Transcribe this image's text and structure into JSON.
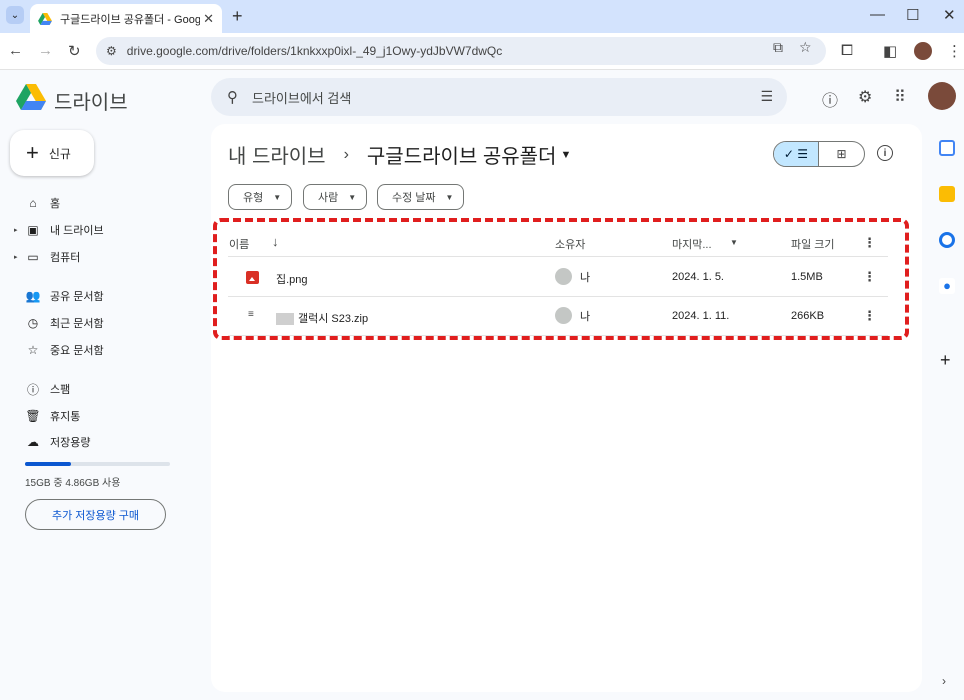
{
  "browser": {
    "tab_title": "구글드라이브 공유폴더 - Google",
    "url": "drive.google.com/drive/folders/1knkxxp0ixl-_49_j1Owy-ydJbVW7dwQc"
  },
  "drive": {
    "app_name": "드라이브",
    "search_placeholder": "드라이브에서 검색"
  },
  "sidebar": {
    "new_label": "신규",
    "items": [
      {
        "label": "홈"
      },
      {
        "label": "내 드라이브"
      },
      {
        "label": "컴퓨터"
      },
      {
        "label": "공유 문서함"
      },
      {
        "label": "최근 문서함"
      },
      {
        "label": "중요 문서함"
      },
      {
        "label": "스팸"
      },
      {
        "label": "휴지통"
      },
      {
        "label": "저장용량"
      }
    ],
    "storage_text": "15GB 중 4.86GB 사용",
    "storage_fraction": 0.32,
    "buy_storage": "추가 저장용량 구매"
  },
  "main": {
    "breadcrumb_root": "내 드라이브",
    "breadcrumb_sep": "›",
    "folder_title": "구글드라이브 공유폴더",
    "filters": [
      "유형",
      "사람",
      "수정 날짜"
    ],
    "columns": {
      "name": "이름",
      "owner": "소유자",
      "modified": "마지막...",
      "size": "파일 크기"
    },
    "files": [
      {
        "name": "집.png",
        "owner": "나",
        "modified": "2024. 1. 5.",
        "size": "1.5MB",
        "type": "image"
      },
      {
        "name": "갤럭시 S23.zip",
        "owner": "나",
        "modified": "2024. 1. 11.",
        "size": "266KB",
        "type": "zip"
      }
    ]
  },
  "colors": {
    "accent": "#0b57d0",
    "highlight_border": "#e01e1e",
    "toggle_active": "#c2e7ff"
  }
}
